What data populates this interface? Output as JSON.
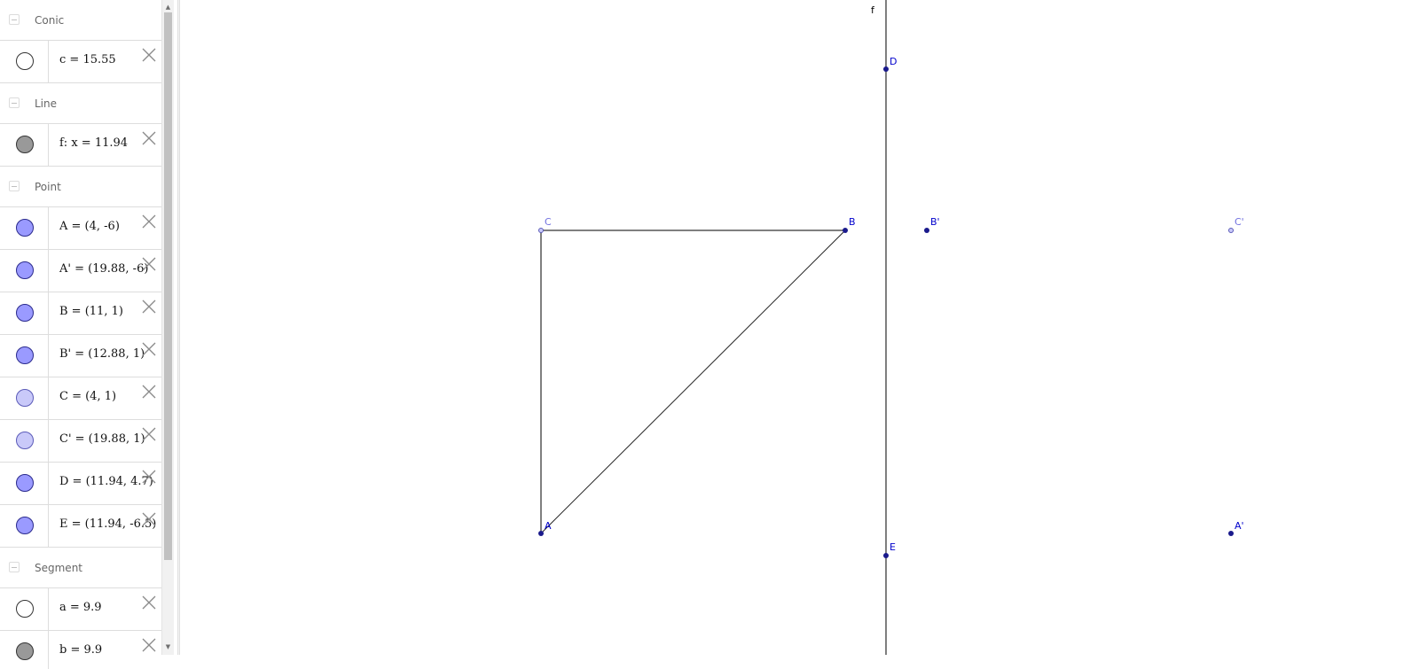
{
  "algebra_view": {
    "groups": [
      {
        "label": "Conic",
        "items": [
          {
            "text": "c = 15.55",
            "marble": "hollow"
          }
        ]
      },
      {
        "label": "Line",
        "items": [
          {
            "text": "f: x = 11.94",
            "marble": "gray"
          }
        ]
      },
      {
        "label": "Point",
        "items": [
          {
            "text": "A = (4, -6)",
            "marble": "blue"
          },
          {
            "text": "A' = (19.88, -6)",
            "marble": "blue"
          },
          {
            "text": "B = (11, 1)",
            "marble": "blue"
          },
          {
            "text": "B' = (12.88, 1)",
            "marble": "blue"
          },
          {
            "text": "C = (4, 1)",
            "marble": "light-blue"
          },
          {
            "text": "C' = (19.88, 1)",
            "marble": "light-blue"
          },
          {
            "text": "D = (11.94, 4.7)",
            "marble": "blue"
          },
          {
            "text": "E = (11.94, -6.5)",
            "marble": "blue"
          }
        ]
      },
      {
        "label": "Segment",
        "items": [
          {
            "text": "a = 9.9",
            "marble": "hollow"
          },
          {
            "text": "b = 9.9",
            "marble": "gray"
          }
        ]
      }
    ]
  },
  "graphics_view": {
    "labels": {
      "line_f": "f",
      "A": "A",
      "A_prime": "A'",
      "B": "B",
      "B_prime": "B'",
      "C": "C",
      "C_prime": "C'",
      "D": "D",
      "E": "E"
    }
  },
  "colors": {
    "point": "#1a1a8c",
    "point_label": "#0000cc",
    "light_point_label": "#6f6fdf",
    "segment": "#444444",
    "marble_blue": "#9a9aff",
    "marble_light_blue": "#c9c9f9",
    "marble_gray": "#999999"
  }
}
